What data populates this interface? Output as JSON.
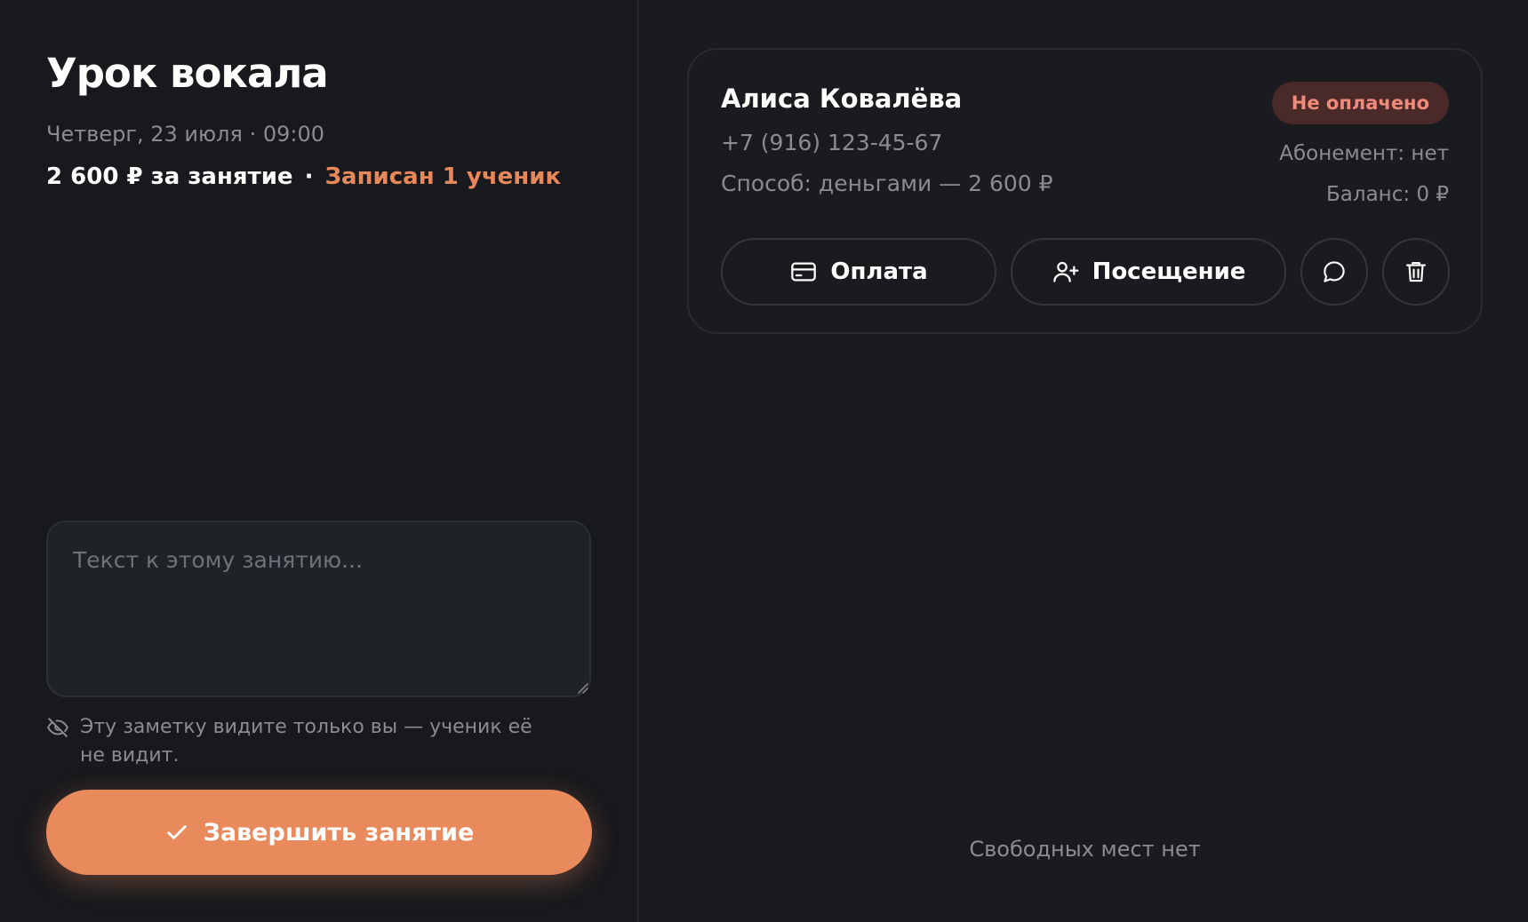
{
  "lesson": {
    "title": "Урок вокала",
    "date_time": "Четверг, 23 июля · 09:00",
    "price": "2 600 ₽ за занятие",
    "separator": "·",
    "enrolled": "Записан 1 ученик"
  },
  "note": {
    "placeholder": "Текст к этому занятию...",
    "value": "",
    "privacy_hint": "Эту заметку видите только вы — ученик её не видит."
  },
  "finish_button": {
    "label": "Завершить занятие",
    "icon": "check-icon"
  },
  "student": {
    "name": "Алиса Ковалёва",
    "phone": "+7 (916) 123-45-67",
    "payment_method": "Способ: деньгами — 2 600 ₽",
    "status": "Не оплачено",
    "subscription": "Абонемент: нет",
    "balance": "Баланс: 0 ₽",
    "actions": {
      "payment_label": "Оплата",
      "attendance_label": "Посещение",
      "payment_icon": "credit-card-icon",
      "attendance_icon": "user-plus-icon",
      "message_icon": "message-icon",
      "delete_icon": "trash-icon"
    }
  },
  "footer": {
    "no_seats": "Свободных мест нет"
  },
  "colors": {
    "accent": "#e98a5c",
    "status_unpaid_bg": "#4a2a28",
    "status_unpaid_text": "#f08a7a"
  }
}
